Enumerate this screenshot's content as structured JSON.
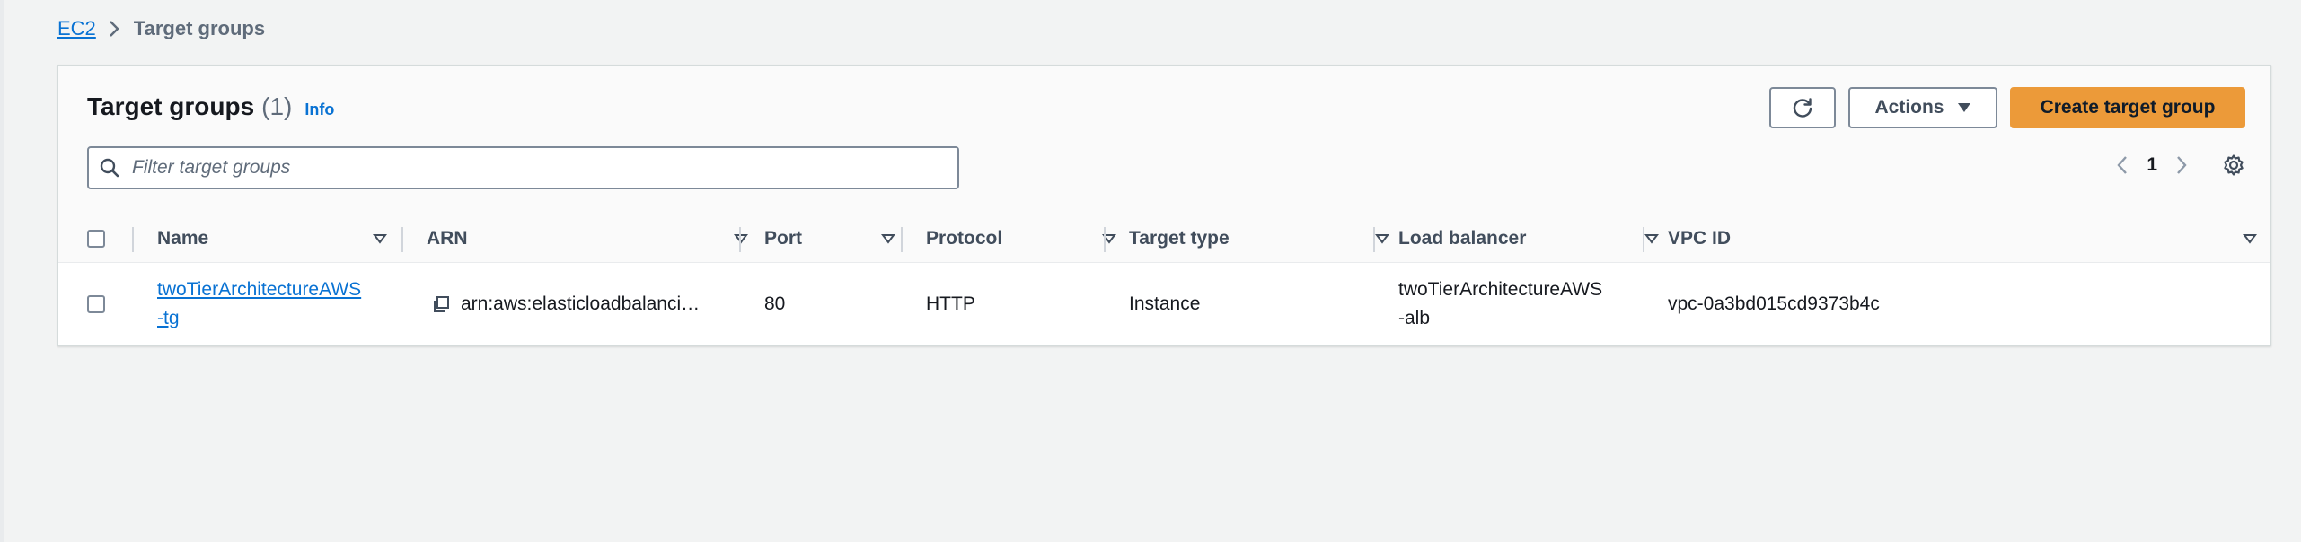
{
  "breadcrumb": {
    "root": "EC2",
    "current": "Target groups"
  },
  "panel": {
    "title": "Target groups",
    "count": "(1)",
    "info": "Info"
  },
  "actions": {
    "actions_label": "Actions",
    "create_label": "Create target group"
  },
  "search": {
    "placeholder": "Filter target groups",
    "value": ""
  },
  "pagination": {
    "current_page": "1"
  },
  "table": {
    "columns": [
      "Name",
      "ARN",
      "Port",
      "Protocol",
      "Target type",
      "Load balancer",
      "VPC ID"
    ],
    "rows": [
      {
        "name_line1": "twoTierArchitectureAWS",
        "name_line2": "-tg",
        "arn": "arn:aws:elasticloadbalanci…",
        "port": "80",
        "protocol": "HTTP",
        "target_type": "Instance",
        "lb_line1": "twoTierArchitectureAWS",
        "lb_line2": "-alb",
        "vpc_id": "vpc-0a3bd015cd9373b4c"
      }
    ]
  },
  "icons": {
    "breadcrumb_separator": "chevron-right-icon",
    "refresh": "refresh-icon",
    "actions_caret": "caret-down-icon",
    "search": "search-icon",
    "prev_page": "chevron-left-icon",
    "next_page": "chevron-right-icon",
    "settings": "gear-icon",
    "sort": "sort-caret-icon",
    "copy": "copy-icon"
  },
  "colors": {
    "link": "#0972d3",
    "primary_button": "#ec9a39",
    "page_background": "#f2f3f3",
    "header_text": "#414d5c"
  }
}
